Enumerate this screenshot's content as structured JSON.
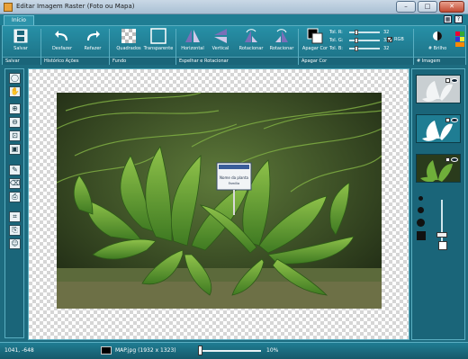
{
  "window": {
    "title": "Editar Imagem Raster (Foto ou Mapa)",
    "minimize": "–",
    "maximize": "□",
    "close": "✕"
  },
  "tabs": [
    {
      "label": "Início"
    }
  ],
  "help_icons": [
    "grid-icon",
    "help-icon"
  ],
  "toolbar": {
    "buttons": [
      {
        "label": "Salvar",
        "icon": "save-icon"
      },
      {
        "label": "Desfazer",
        "icon": "undo-icon"
      },
      {
        "label": "Refazer",
        "icon": "redo-icon"
      },
      {
        "label": "Quadrados",
        "icon": "checker-icon"
      },
      {
        "label": "Transparente",
        "icon": "transparent-icon"
      },
      {
        "label": "Horizontal",
        "icon": "flip-horizontal-icon"
      },
      {
        "label": "Vertical",
        "icon": "flip-vertical-icon"
      },
      {
        "label": "Rotacionar",
        "icon": "rotate-left-icon"
      },
      {
        "label": "Rotacionar",
        "icon": "rotate-right-icon"
      },
      {
        "label": "Apagar Cor",
        "icon": "erase-color-icon"
      },
      {
        "label": "# Brilho",
        "icon": "brightness-icon"
      }
    ],
    "groups": [
      "Salvar",
      "Histórico Ações",
      "Fundo",
      "Espelhar e Rotacionar",
      "Apagar Cor",
      "# Imagem"
    ]
  },
  "tolerance": {
    "rows": [
      {
        "label": "Tol. R:",
        "value": "32"
      },
      {
        "label": "Tol. G:",
        "value": "32"
      },
      {
        "label": "Tol. B:",
        "value": "32"
      }
    ],
    "rgb_label": "RGB",
    "rgb_checked": true
  },
  "left_tools": [
    "lasso-icon",
    "hand-icon",
    "zoom-in-icon",
    "zoom-out-icon",
    "zoom-fit-icon",
    "zoom-actual-icon",
    "pencil-icon",
    "eraser-icon",
    "stamp-icon",
    "crop-icon",
    "paste-icon",
    "person-icon"
  ],
  "layers": [
    {
      "name": "layer-silhouette-gray",
      "visible": true,
      "checked": true
    },
    {
      "name": "layer-silhouette-white",
      "visible": true,
      "checked": true
    },
    {
      "name": "layer-photo",
      "visible": true,
      "checked": true
    }
  ],
  "photo": {
    "filename": "MAP.jpg",
    "sign_text": "Nome da planta",
    "sign_sub": "Família"
  },
  "status": {
    "coords": "1041, -648",
    "fileinfo": "MAP.jpg (1932 x 1323)",
    "zoom": "10%",
    "zoom_fraction": 0.02
  },
  "colors": {
    "accent": "#1f7d93",
    "panel": "#1a6579",
    "border": "#5aaec1"
  }
}
